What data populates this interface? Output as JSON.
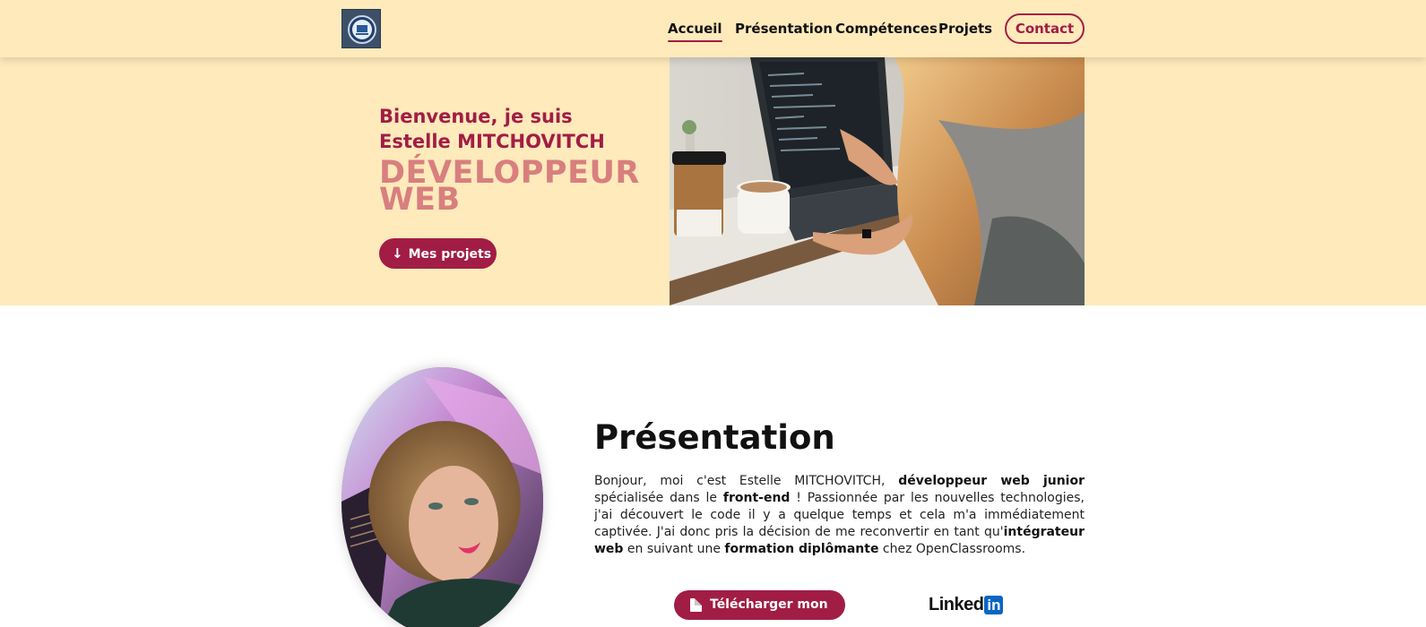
{
  "header": {
    "logo_alt": "logo",
    "nav": [
      {
        "label": "Accueil",
        "active": true
      },
      {
        "label": "Présentation",
        "active": false
      },
      {
        "label": "Compétences",
        "active": false
      },
      {
        "label": "Projets",
        "active": false
      }
    ],
    "contact_label": "Contact"
  },
  "hero": {
    "greeting": "Bienvenue, je suis Estelle MITCHOVITCH",
    "title_line1": "DÉVELOPPEUR",
    "title_line2": "WEB",
    "button_label": "Mes projets",
    "button_icon": "arrow-down-icon"
  },
  "presentation": {
    "title": "Présentation",
    "text": {
      "p1": "Bonjour, moi c'est Estelle MITCHOVITCH, ",
      "b1": "développeur web junior",
      "p2": " spécialisée dans le ",
      "b2": "front-end",
      "p3": " ! Passionnée par les nouvelles technologies, j'ai découvert le code il y a quelque temps et cela m'a immédiatement captivée. J'ai donc pris la décision de me reconvertir en tant qu'",
      "b3": "intégrateur web",
      "p4": " en suivant une ",
      "b4": "formation diplômante",
      "p5": " chez OpenClassrooms."
    },
    "cv_button_label": "Télécharger mon CV",
    "cv_button_icon": "pdf-icon",
    "linkedin_text": "Linked",
    "linkedin_badge": "in"
  },
  "colors": {
    "accent": "#a11d45",
    "hero_bg": "#feeabb",
    "title_pink": "#d87f7f",
    "linkedin_blue": "#0a66c2"
  }
}
